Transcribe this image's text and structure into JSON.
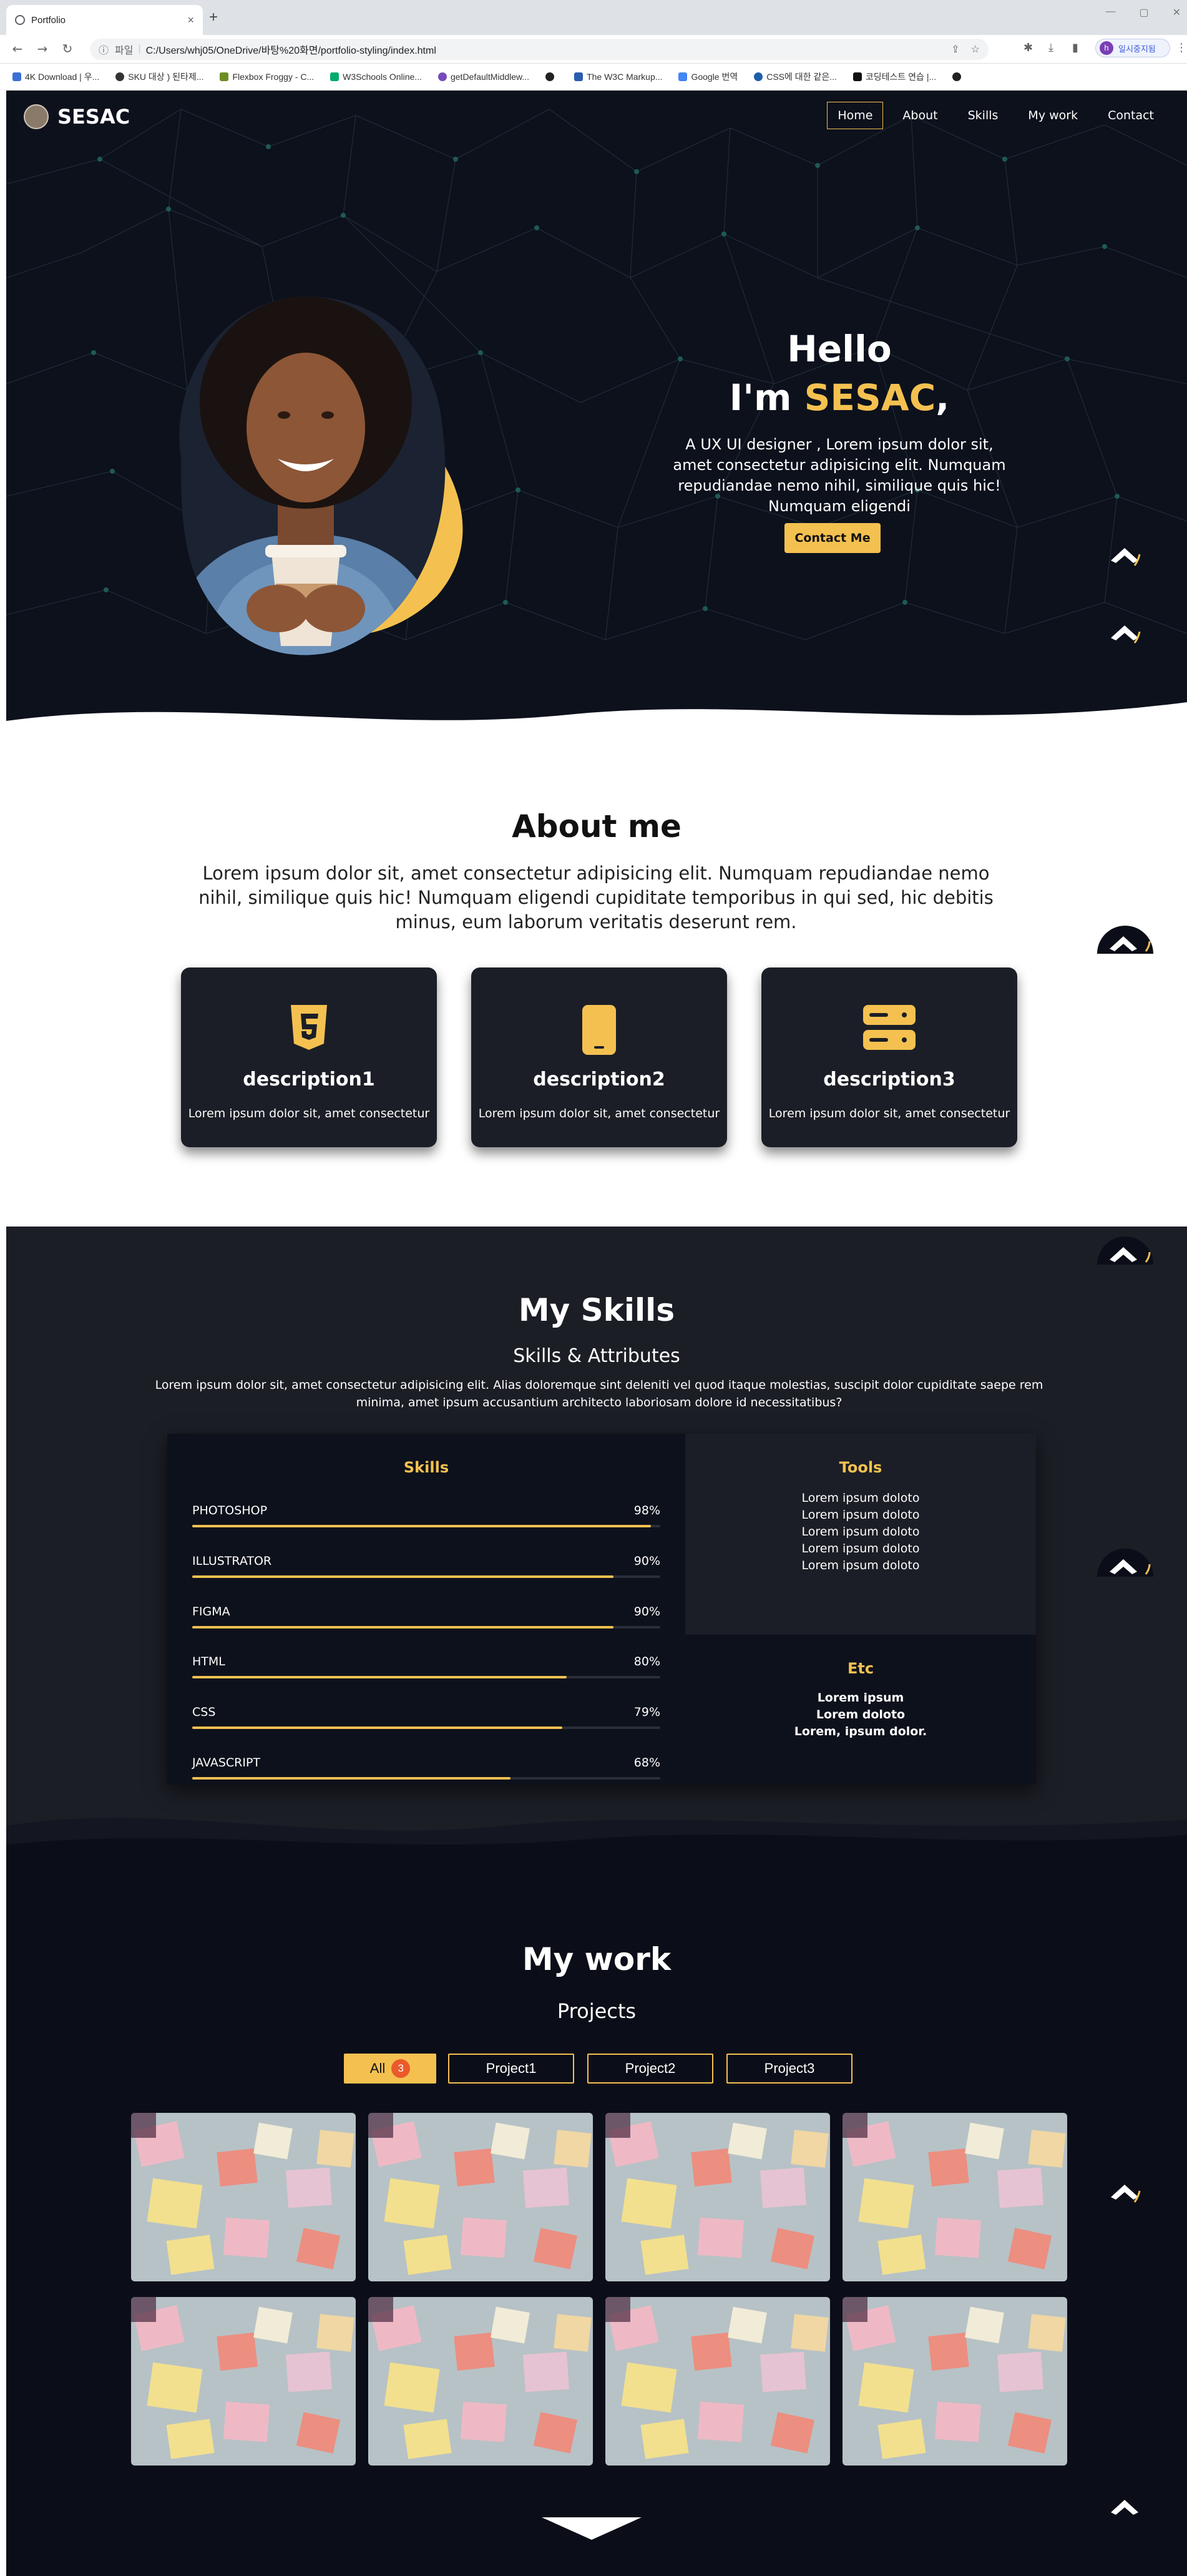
{
  "browser": {
    "tab_title": "Portfolio",
    "new_tab": "+",
    "window_controls": [
      "—",
      "▢",
      "✕"
    ],
    "address_scheme": "파일",
    "address_path": "C:/Users/whj05/OneDrive/바탕%20화면/portfolio-styling/index.html",
    "profile_initial": "h",
    "profile_label": "일시중지됨",
    "bookmarks": [
      "4K Download | 우...",
      "SKU 대상 ) 된타제...",
      "Flexbox Froggy - C...",
      "W3Schools Online...",
      "getDefaultMiddlew...",
      "",
      "The W3C Markup...",
      "Google 번역",
      "CSS에 대한 같은...",
      "코딩테스트 연습 |..."
    ]
  },
  "nav": {
    "brand": "SESAC",
    "links": [
      "Home",
      "About",
      "Skills",
      "My work",
      "Contact"
    ],
    "active_index": 0
  },
  "hero": {
    "line1": "Hello",
    "line2_prefix": "I'm ",
    "line2_accent": "SESAC",
    "line2_suffix": ",",
    "description": "A UX UI designer , Lorem ipsum dolor sit, amet consectetur adipisicing elit. Numquam repudiandae nemo nihil, similique quis hic! Numquam eligendi",
    "cta": "Contact Me"
  },
  "about": {
    "title": "About me",
    "text": "Lorem ipsum dolor sit, amet consectetur adipisicing elit. Numquam repudiandae nemo nihil, similique quis hic! Numquam eligendi cupiditate temporibus in qui sed, hic debitis minus, eum laborum veritatis deserunt rem.",
    "cards": [
      {
        "icon": "html5-icon",
        "title": "description1",
        "text": "Lorem ipsum dolor sit, amet consectetur"
      },
      {
        "icon": "mobile-icon",
        "title": "description2",
        "text": "Lorem ipsum dolor sit, amet consectetur"
      },
      {
        "icon": "server-icon",
        "title": "description3",
        "text": "Lorem ipsum dolor sit, amet consectetur"
      }
    ]
  },
  "skills": {
    "title": "My Skills",
    "subtitle": "Skills & Attributes",
    "lead": "Lorem ipsum dolor sit, amet consectetur adipisicing elit. Alias doloremque sint deleniti vel quod itaque molestias, suscipit dolor cupiditate saepe rem minima, amet ipsum accusantium architecto laboriosam dolore id necessitatibus?",
    "skills_heading": "Skills",
    "items": [
      {
        "name": "PHOTOSHOP",
        "value": 98,
        "label": "98%"
      },
      {
        "name": "ILLUSTRATOR",
        "value": 90,
        "label": "90%"
      },
      {
        "name": "FIGMA",
        "value": 90,
        "label": "90%"
      },
      {
        "name": "HTML",
        "value": 80,
        "label": "80%"
      },
      {
        "name": "CSS",
        "value": 79,
        "label": "79%"
      },
      {
        "name": "JAVASCRIPT",
        "value": 68,
        "label": "68%"
      }
    ],
    "tools_heading": "Tools",
    "tools": [
      "Lorem ipsum doloto",
      "Lorem ipsum doloto",
      "Lorem ipsum doloto",
      "Lorem ipsum doloto",
      "Lorem ipsum doloto"
    ],
    "etc_heading": "Etc",
    "etc": [
      "Lorem ipsum",
      "Lorem doloto",
      "Lorem, ipsum dolor."
    ]
  },
  "work": {
    "title": "My work",
    "subtitle": "Projects",
    "filters": [
      {
        "label": "All",
        "count": "3"
      },
      {
        "label": "Project1"
      },
      {
        "label": "Project2"
      },
      {
        "label": "Project3"
      }
    ],
    "thumbnail_count": 8
  },
  "colors": {
    "accent": "#f4c150",
    "dark": "#0c111c",
    "card": "#1b1e26",
    "badge": "#ea5a2b"
  }
}
